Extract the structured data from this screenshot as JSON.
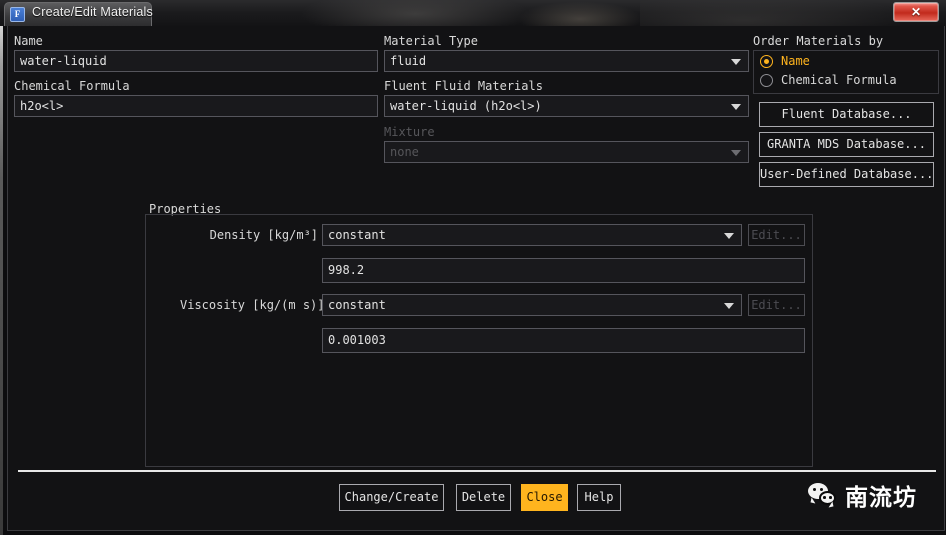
{
  "window": {
    "title": "Create/Edit Materials",
    "icon": "fluent-f-icon",
    "close_label": "✕"
  },
  "left_column": {
    "name_label": "Name",
    "name_value": "water-liquid",
    "chemical_formula_label": "Chemical Formula",
    "chemical_formula_value": "h2o<l>"
  },
  "middle_column": {
    "material_type_label": "Material Type",
    "material_type_value": "fluid",
    "fluent_fluid_materials_label": "Fluent Fluid Materials",
    "fluent_fluid_materials_value": "water-liquid (h2o<l>)",
    "mixture_label": "Mixture",
    "mixture_value": "none"
  },
  "order_by": {
    "title": "Order Materials by",
    "options": [
      {
        "label": "Name",
        "selected": true
      },
      {
        "label": "Chemical Formula",
        "selected": false
      }
    ]
  },
  "database_buttons": [
    {
      "label": "Fluent Database..."
    },
    {
      "label": "GRANTA MDS Database..."
    },
    {
      "label": "User-Defined Database..."
    }
  ],
  "properties": {
    "title": "Properties",
    "rows": [
      {
        "label": "Density [kg/m³]",
        "method": "constant",
        "value": "998.2",
        "edit_label": "Edit...",
        "edit_enabled": false
      },
      {
        "label": "Viscosity [kg/(m s)]",
        "method": "constant",
        "value": "0.001003",
        "edit_label": "Edit...",
        "edit_enabled": false
      }
    ]
  },
  "footer": {
    "buttons": [
      {
        "label": "Change/Create",
        "accent": false
      },
      {
        "label": "Delete",
        "accent": false
      },
      {
        "label": "Close",
        "accent": true
      },
      {
        "label": "Help",
        "accent": false
      }
    ]
  },
  "watermark": {
    "text": "南流坊",
    "logo": "wechat-icon"
  },
  "colors": {
    "accent": "#ffb41e",
    "background": "#121214",
    "field_background": "#19191c",
    "text": "#d9d9d9",
    "disabled_text": "#56565a",
    "close_button_red": "#c12a1c"
  }
}
